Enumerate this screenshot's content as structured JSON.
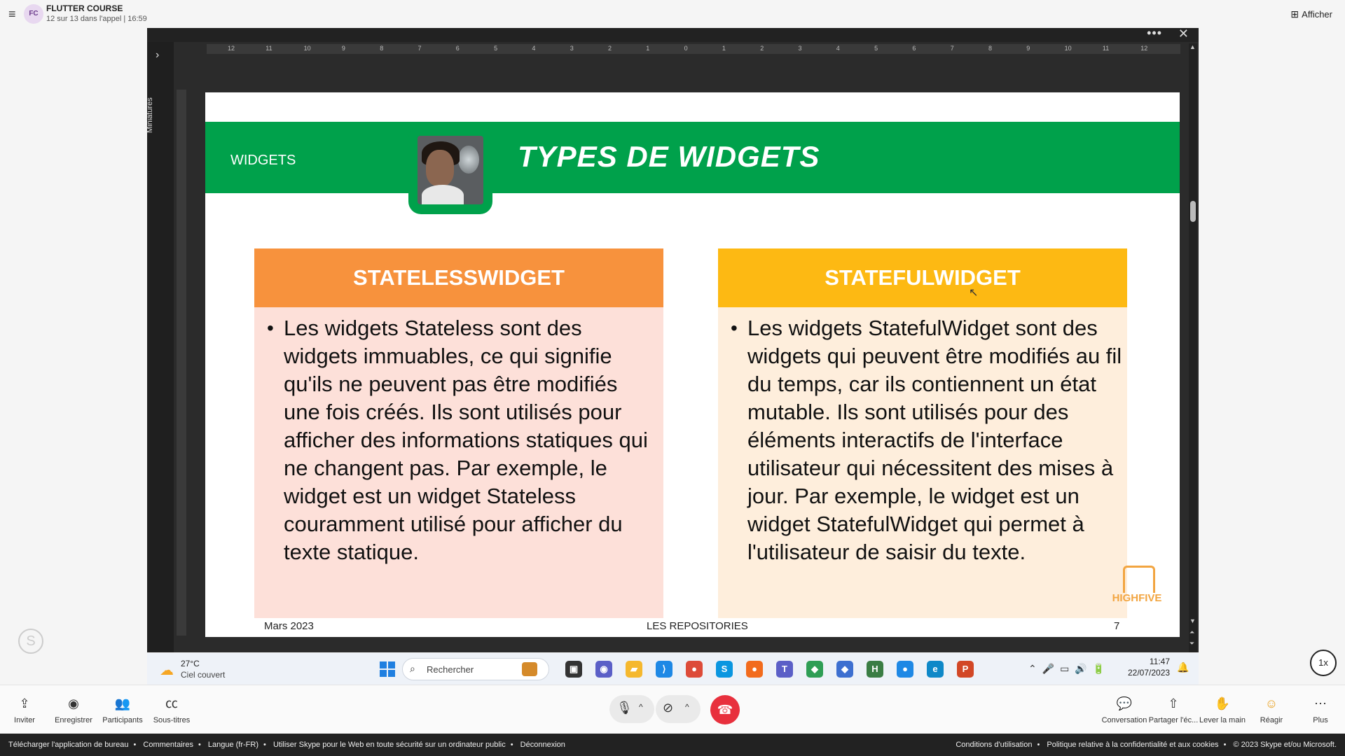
{
  "header": {
    "avatar_initials": "FC",
    "call_title": "FLUTTER COURSE",
    "call_subtitle": "12 sur 13 dans l'appel | 16:59",
    "view_button": "Afficher"
  },
  "viewer": {
    "thumbnails_label": "Miniatures",
    "slide": {
      "section_label": "WIDGETS",
      "title": "TYPES DE WIDGETS",
      "left_card": {
        "heading": "STATELESSWIDGET",
        "text": "Les widgets Stateless sont des widgets immuables, ce qui signifie qu'ils ne peuvent pas être modifiés une fois créés. Ils sont utilisés pour afficher des informations statiques qui ne changent pas. Par exemple, le widget est un widget Stateless couramment utilisé pour afficher du texte statique."
      },
      "right_card": {
        "heading": "STATEFULWIDGET",
        "text": "Les widgets StatefulWidget sont des widgets qui peuvent être modifiés au fil du temps, car ils contiennent un état mutable. Ils sont utilisés pour des éléments interactifs de l'interface utilisateur qui nécessitent des mises à jour. Par exemple, le widget est un widget StatefulWidget qui permet à l'utilisateur de saisir du texte."
      },
      "footer_date": "Mars 2023",
      "footer_center": "LES REPOSITORIES",
      "page_number": "7",
      "logo_text": "HIGHFIVE"
    },
    "ruler_ticks": [
      "12",
      "11",
      "10",
      "9",
      "8",
      "7",
      "6",
      "5",
      "4",
      "3",
      "2",
      "1",
      "0",
      "1",
      "2",
      "3",
      "4",
      "5",
      "6",
      "7",
      "8",
      "9",
      "10",
      "11",
      "12"
    ]
  },
  "taskbar": {
    "weather_temp": "27°C",
    "weather_desc": "Ciel couvert",
    "search_placeholder": "Rechercher",
    "time": "11:47",
    "date": "22/07/2023",
    "apps": [
      {
        "name": "file-explorer-icon",
        "glyph": "▣",
        "color": "#333333"
      },
      {
        "name": "teams-chat-icon",
        "glyph": "◉",
        "color": "#5b5fc7"
      },
      {
        "name": "folder-icon",
        "glyph": "▰",
        "color": "#f5b82e"
      },
      {
        "name": "vscode-icon",
        "glyph": "⟩",
        "color": "#1e88e5"
      },
      {
        "name": "chrome-icon",
        "glyph": "●",
        "color": "#dd4b39"
      },
      {
        "name": "skype-icon",
        "glyph": "S",
        "color": "#0a96e0"
      },
      {
        "name": "firefox-icon",
        "glyph": "●",
        "color": "#f26b1d"
      },
      {
        "name": "teams-icon",
        "glyph": "T",
        "color": "#5b5fc7"
      },
      {
        "name": "app-green-icon",
        "glyph": "◆",
        "color": "#2e9e55"
      },
      {
        "name": "app-blue-icon",
        "glyph": "◆",
        "color": "#3d6fd0"
      },
      {
        "name": "hs-app-icon",
        "glyph": "H",
        "color": "#3a7d44"
      },
      {
        "name": "app-circle-icon",
        "glyph": "●",
        "color": "#1e88e5"
      },
      {
        "name": "edge-icon",
        "glyph": "e",
        "color": "#0e88c8"
      },
      {
        "name": "powerpoint-icon",
        "glyph": "P",
        "color": "#d24726"
      }
    ]
  },
  "speed": "1x",
  "toolbar": {
    "invite": "Inviter",
    "record": "Enregistrer",
    "participants": "Participants",
    "subtitles": "Sous-titres",
    "conversation": "Conversation",
    "share": "Partager l'éc...",
    "raise_hand": "Lever la main",
    "react": "Réagir",
    "more": "Plus"
  },
  "footer": {
    "download": "Télécharger l'application de bureau",
    "comments": "Commentaires",
    "language": "Langue (fr-FR)",
    "safe_use": "Utiliser Skype pour le Web en toute sécurité sur un ordinateur public",
    "logout": "Déconnexion",
    "terms": "Conditions d'utilisation",
    "privacy": "Politique relative à la confidentialité et aux cookies",
    "copyright": "© 2023 Skype et/ou Microsoft."
  },
  "colors": {
    "banner_green": "#00a14b",
    "stateless_orange": "#f7923d",
    "stateful_yellow": "#fdb913",
    "hangup_red": "#e8303d"
  }
}
